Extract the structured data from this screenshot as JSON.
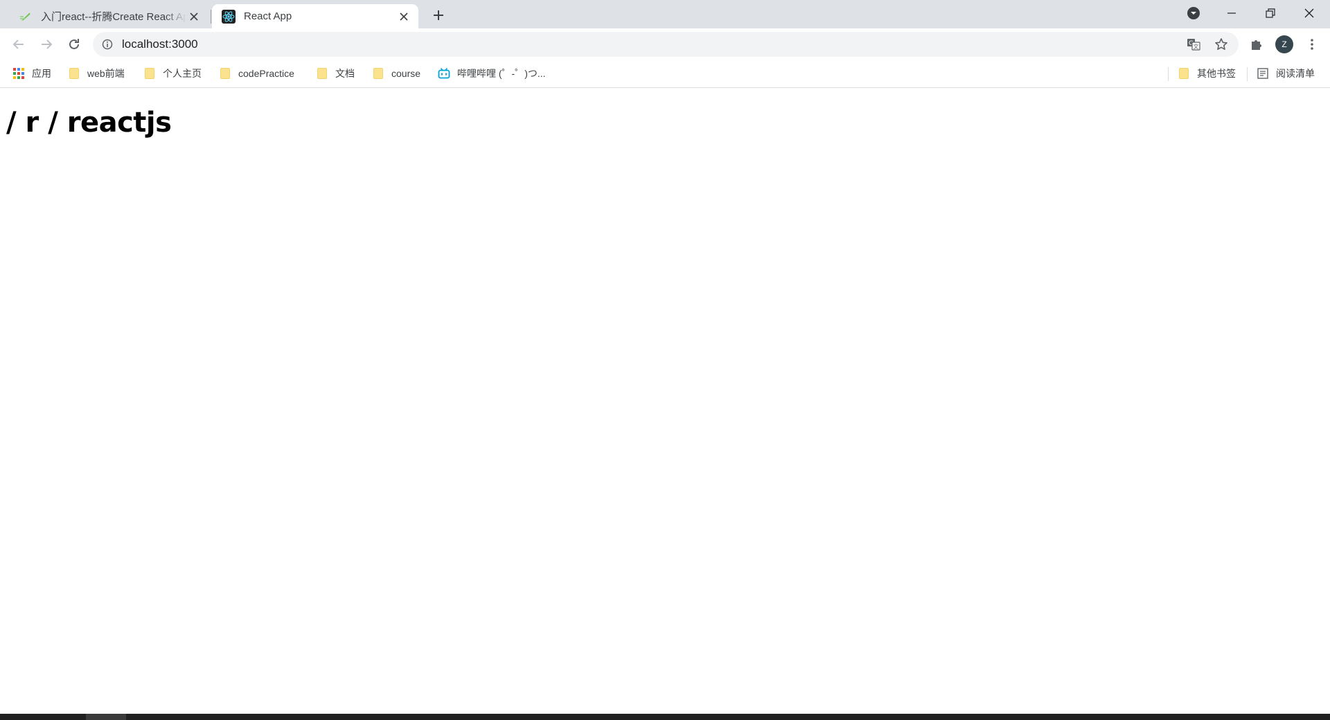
{
  "browser": {
    "tabs": [
      {
        "title": "入门react--折腾Create React App",
        "active": false
      },
      {
        "title": "React App",
        "active": true
      }
    ],
    "address_bar": {
      "url": "localhost:3000"
    },
    "profile_initial": "Z",
    "icons": {
      "back": "arrow-left-icon",
      "forward": "arrow-right-icon",
      "reload": "reload-icon",
      "site_info": "info-icon",
      "translate": "translate-icon",
      "bookmark": "star-icon",
      "extensions": "puzzle-icon",
      "menu": "kebab-menu-icon"
    }
  },
  "bookmarks_bar": {
    "apps_label": "应用",
    "items": [
      {
        "label": "web前端",
        "icon": "folder-icon"
      },
      {
        "label": "个人主页",
        "icon": "folder-icon"
      },
      {
        "label": "codePractice",
        "icon": "folder-icon"
      },
      {
        "label": "文档",
        "icon": "folder-icon"
      },
      {
        "label": "course",
        "icon": "folder-icon"
      },
      {
        "label": "哔哩哔哩 (゜-゜)つ...",
        "icon": "bilibili-icon"
      }
    ],
    "other_bookmarks": "其他书签",
    "reading_list": "阅读清单"
  },
  "page": {
    "heading": "/ r / reactjs"
  },
  "colors": {
    "tabstrip": "#dee1e6",
    "omnibox": "#f1f3f4",
    "folder": "#fbe28e",
    "bilibili": "#00a1d6",
    "react": "#61dafb"
  }
}
